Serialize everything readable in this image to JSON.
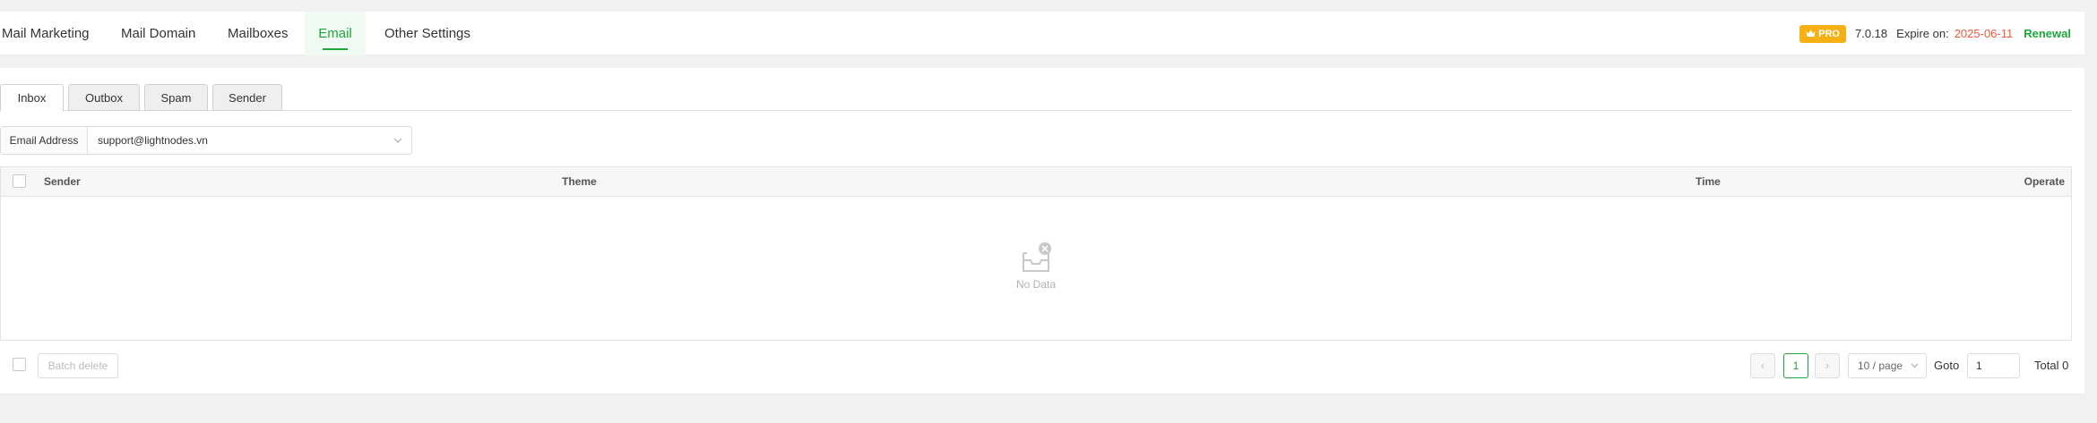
{
  "nav": {
    "tabs": [
      {
        "label": "Mail Marketing"
      },
      {
        "label": "Mail Domain"
      },
      {
        "label": "Mailboxes"
      },
      {
        "label": "Email"
      },
      {
        "label": "Other Settings"
      }
    ],
    "active_tab": "Email"
  },
  "status": {
    "badge": "PRO",
    "version": "7.0.18",
    "expire_label": "Expire on:",
    "expire_date": "2025-06-11",
    "renewal": "Renewal"
  },
  "mail_tabs": [
    {
      "label": "Inbox"
    },
    {
      "label": "Outbox"
    },
    {
      "label": "Spam"
    },
    {
      "label": "Sender"
    }
  ],
  "active_mail_tab": "Inbox",
  "email_filter": {
    "label": "Email Address",
    "value": "support@lightnodes.vn"
  },
  "table": {
    "columns": [
      "Sender",
      "Theme",
      "Time",
      "Operate"
    ],
    "rows": [],
    "empty_text": "No Data"
  },
  "footer": {
    "batch_delete": "Batch delete"
  },
  "pagination": {
    "prev": "‹",
    "current_page": "1",
    "next": "›",
    "page_size": "10 / page",
    "goto_label": "Goto",
    "goto_value": "1",
    "total": "Total 0"
  },
  "colors": {
    "accent": "#20a53a",
    "expire": "#ef5a3a",
    "pro_badge": "#f5b014"
  }
}
